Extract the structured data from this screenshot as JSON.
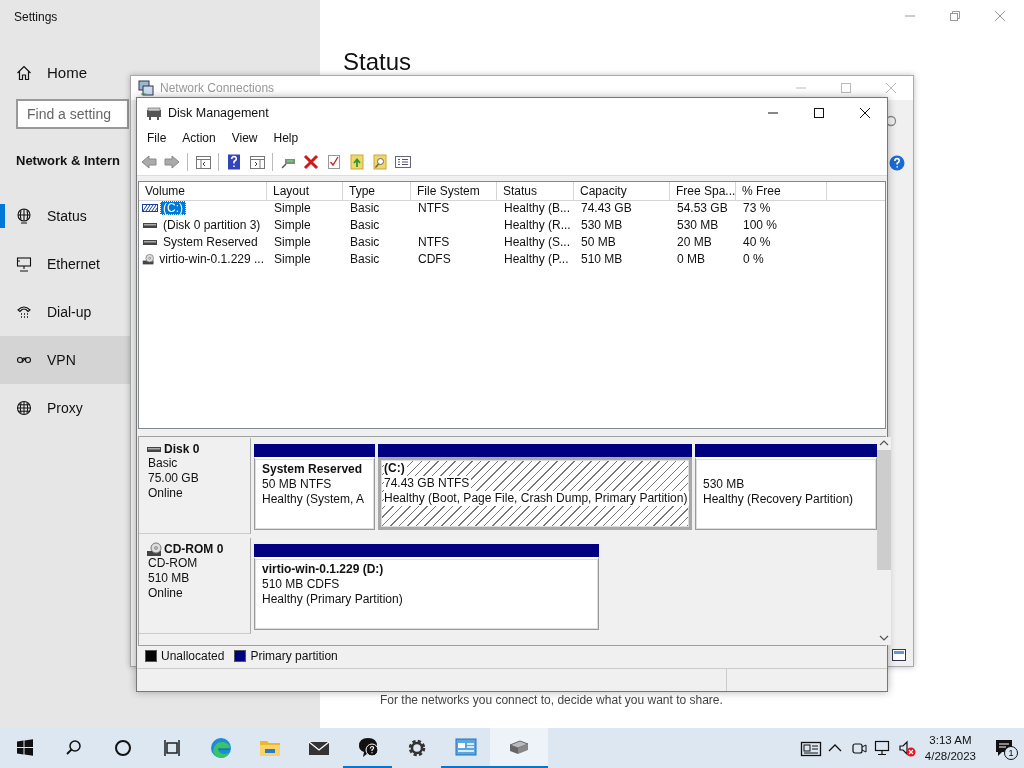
{
  "settings": {
    "title": "Settings",
    "home": "Home",
    "search": {
      "placeholder": "Find a setting"
    },
    "section": "Network & Intern",
    "nav": [
      {
        "label": "Status",
        "selected": true,
        "hovered": false
      },
      {
        "label": "Ethernet",
        "selected": false,
        "hovered": false
      },
      {
        "label": "Dial-up",
        "selected": false,
        "hovered": false
      },
      {
        "label": "VPN",
        "selected": false,
        "hovered": true
      },
      {
        "label": "Proxy",
        "selected": false,
        "hovered": false
      }
    ],
    "heading": "Status",
    "footer_text": "For the networks you connect to, decide what you want to share."
  },
  "network_connections": {
    "title": "Network Connections"
  },
  "disk_management": {
    "title": "Disk Management",
    "menu": [
      "File",
      "Action",
      "View",
      "Help"
    ],
    "columns": [
      "Volume",
      "Layout",
      "Type",
      "File System",
      "Status",
      "Capacity",
      "Free Spa...",
      "% Free"
    ],
    "volumes": [
      {
        "kind": "hatched",
        "selected": true,
        "cells": [
          "(C:)",
          "Simple",
          "Basic",
          "NTFS",
          "Healthy (B...",
          "74.43 GB",
          "54.53 GB",
          "73 %"
        ]
      },
      {
        "kind": "basic",
        "selected": false,
        "cells": [
          "(Disk 0 partition 3)",
          "Simple",
          "Basic",
          "",
          "Healthy (R...",
          "530 MB",
          "530 MB",
          "100 %"
        ]
      },
      {
        "kind": "basic",
        "selected": false,
        "cells": [
          "System Reserved",
          "Simple",
          "Basic",
          "NTFS",
          "Healthy (S...",
          "50 MB",
          "20 MB",
          "40 %"
        ]
      },
      {
        "kind": "cdrom",
        "selected": false,
        "cells": [
          "virtio-win-0.1.229 ...",
          "Simple",
          "Basic",
          "CDFS",
          "Healthy (P...",
          "510 MB",
          "0 MB",
          "0 %"
        ]
      }
    ],
    "disks": [
      {
        "kind": "disk",
        "name": "Disk 0",
        "lines": [
          "Basic",
          "75.00 GB",
          "Online"
        ],
        "partitions": [
          {
            "name": "System Reserved",
            "lines": [
              "50 MB NTFS",
              "Healthy (System, A"
            ],
            "selected": false
          },
          {
            "name": "(C:)",
            "lines": [
              "74.43 GB NTFS",
              "Healthy (Boot, Page File, Crash Dump, Primary Partition)"
            ],
            "selected": true
          },
          {
            "lines": [
              "530 MB",
              "Healthy (Recovery Partition)"
            ],
            "selected": false
          }
        ]
      },
      {
        "kind": "cdrom",
        "name": "CD-ROM 0",
        "lines": [
          "CD-ROM",
          "510 MB",
          "Online"
        ],
        "partitions": [
          {
            "name": "virtio-win-0.1.229  (D:)",
            "lines": [
              "510 MB CDFS",
              "Healthy (Primary Partition)"
            ],
            "selected": false
          }
        ]
      }
    ],
    "legend": [
      {
        "label": "Unallocated",
        "color": "#000000"
      },
      {
        "label": "Primary partition",
        "color": "#000080"
      }
    ]
  },
  "taskbar": {
    "apps": [
      {
        "running": false,
        "selected": false
      },
      {
        "running": false,
        "selected": false
      },
      {
        "running": false,
        "selected": false
      },
      {
        "running": true,
        "selected": false
      },
      {
        "running": false,
        "selected": false
      },
      {
        "running": true,
        "selected": false
      },
      {
        "running": true,
        "selected": true
      }
    ],
    "time": "3:13 AM",
    "date": "4/28/2023",
    "notifications": "1"
  }
}
